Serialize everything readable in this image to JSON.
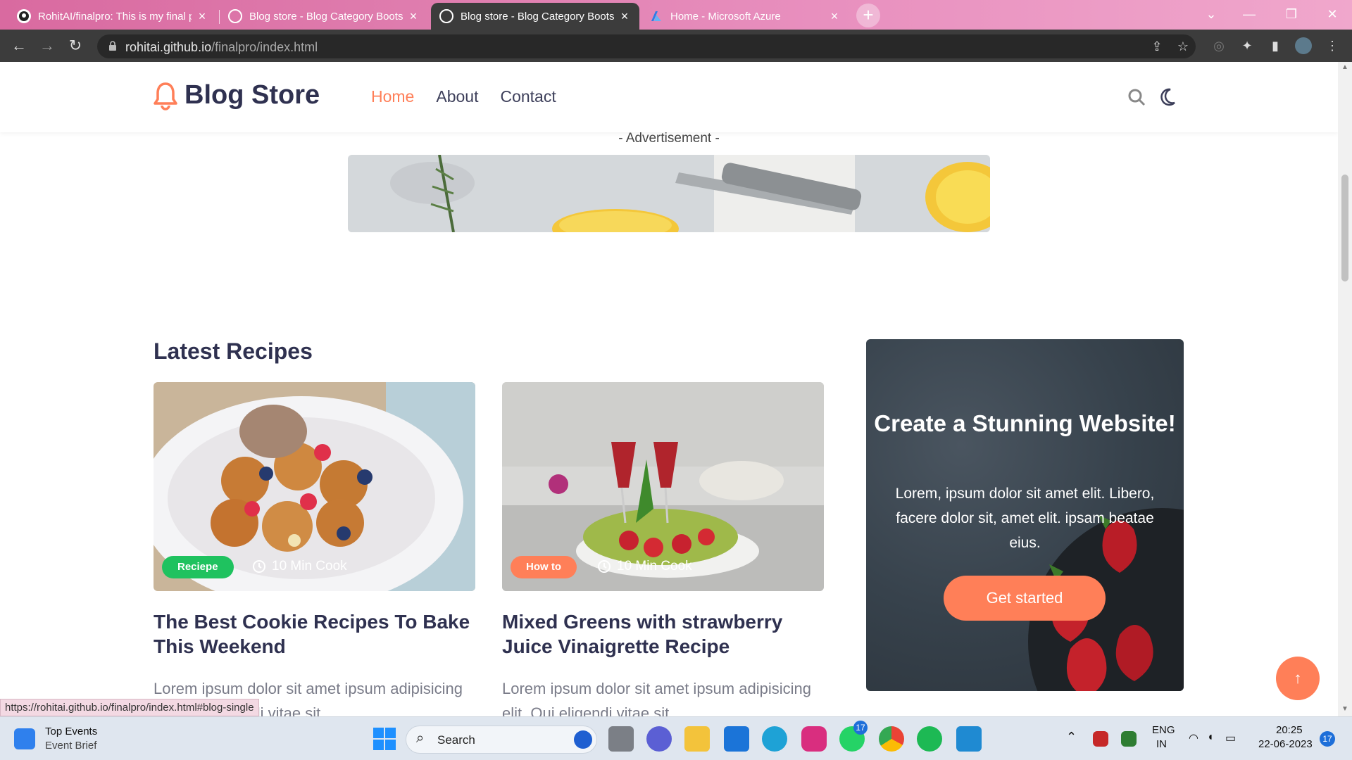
{
  "browser": {
    "tabs": [
      {
        "title": "RohitAI/finalpro: This is my final p",
        "icon": "github-icon",
        "active": false
      },
      {
        "title": "Blog store - Blog Category Boots",
        "icon": "globe-icon",
        "active": false
      },
      {
        "title": "Blog store - Blog Category Boots",
        "icon": "globe-icon",
        "active": true
      },
      {
        "title": "Home - Microsoft Azure",
        "icon": "azure-icon",
        "active": false
      }
    ],
    "url_host": "rohitai.github.io",
    "url_path": "/finalpro/index.html",
    "status_url": "https://rohitai.github.io/finalpro/index.html#blog-single"
  },
  "site": {
    "logo_text": "Blog Store",
    "nav": [
      {
        "label": "Home",
        "active": true
      },
      {
        "label": "About",
        "active": false
      },
      {
        "label": "Contact",
        "active": false
      }
    ],
    "ad_label": "- Advertisement -",
    "section_title": "Latest Recipes",
    "cards": [
      {
        "tag": "Reciepe",
        "tag_color": "#1fc25f",
        "cook_time": "10 Min Cook",
        "title": "The Best Cookie Recipes To Bake This Weekend",
        "excerpt": "Lorem ipsum dolor sit amet ipsum adipisicing elit. Qui eligendi vitae sit."
      },
      {
        "tag": "How to",
        "tag_color": "#ff7f58",
        "cook_time": "10 Min Cook",
        "title": "Mixed Greens with strawberry Juice Vinaigrette Recipe",
        "excerpt": "Lorem ipsum dolor sit amet ipsum adipisicing elit. Qui eligendi vitae sit."
      }
    ],
    "promo": {
      "title": "Create a Stunning Website!",
      "text": "Lorem, ipsum dolor sit amet elit. Libero, facere dolor sit, amet elit. ipsam beatae eius.",
      "button": "Get started"
    },
    "accent": "#ff7f58"
  },
  "taskbar": {
    "widget_title": "Top Events",
    "widget_sub": "Event Brief",
    "search_label": "Search",
    "whatsapp_badge": "17",
    "lang_top": "ENG",
    "lang_bottom": "IN",
    "time": "20:25",
    "date": "22-06-2023",
    "notif_count": "17"
  }
}
